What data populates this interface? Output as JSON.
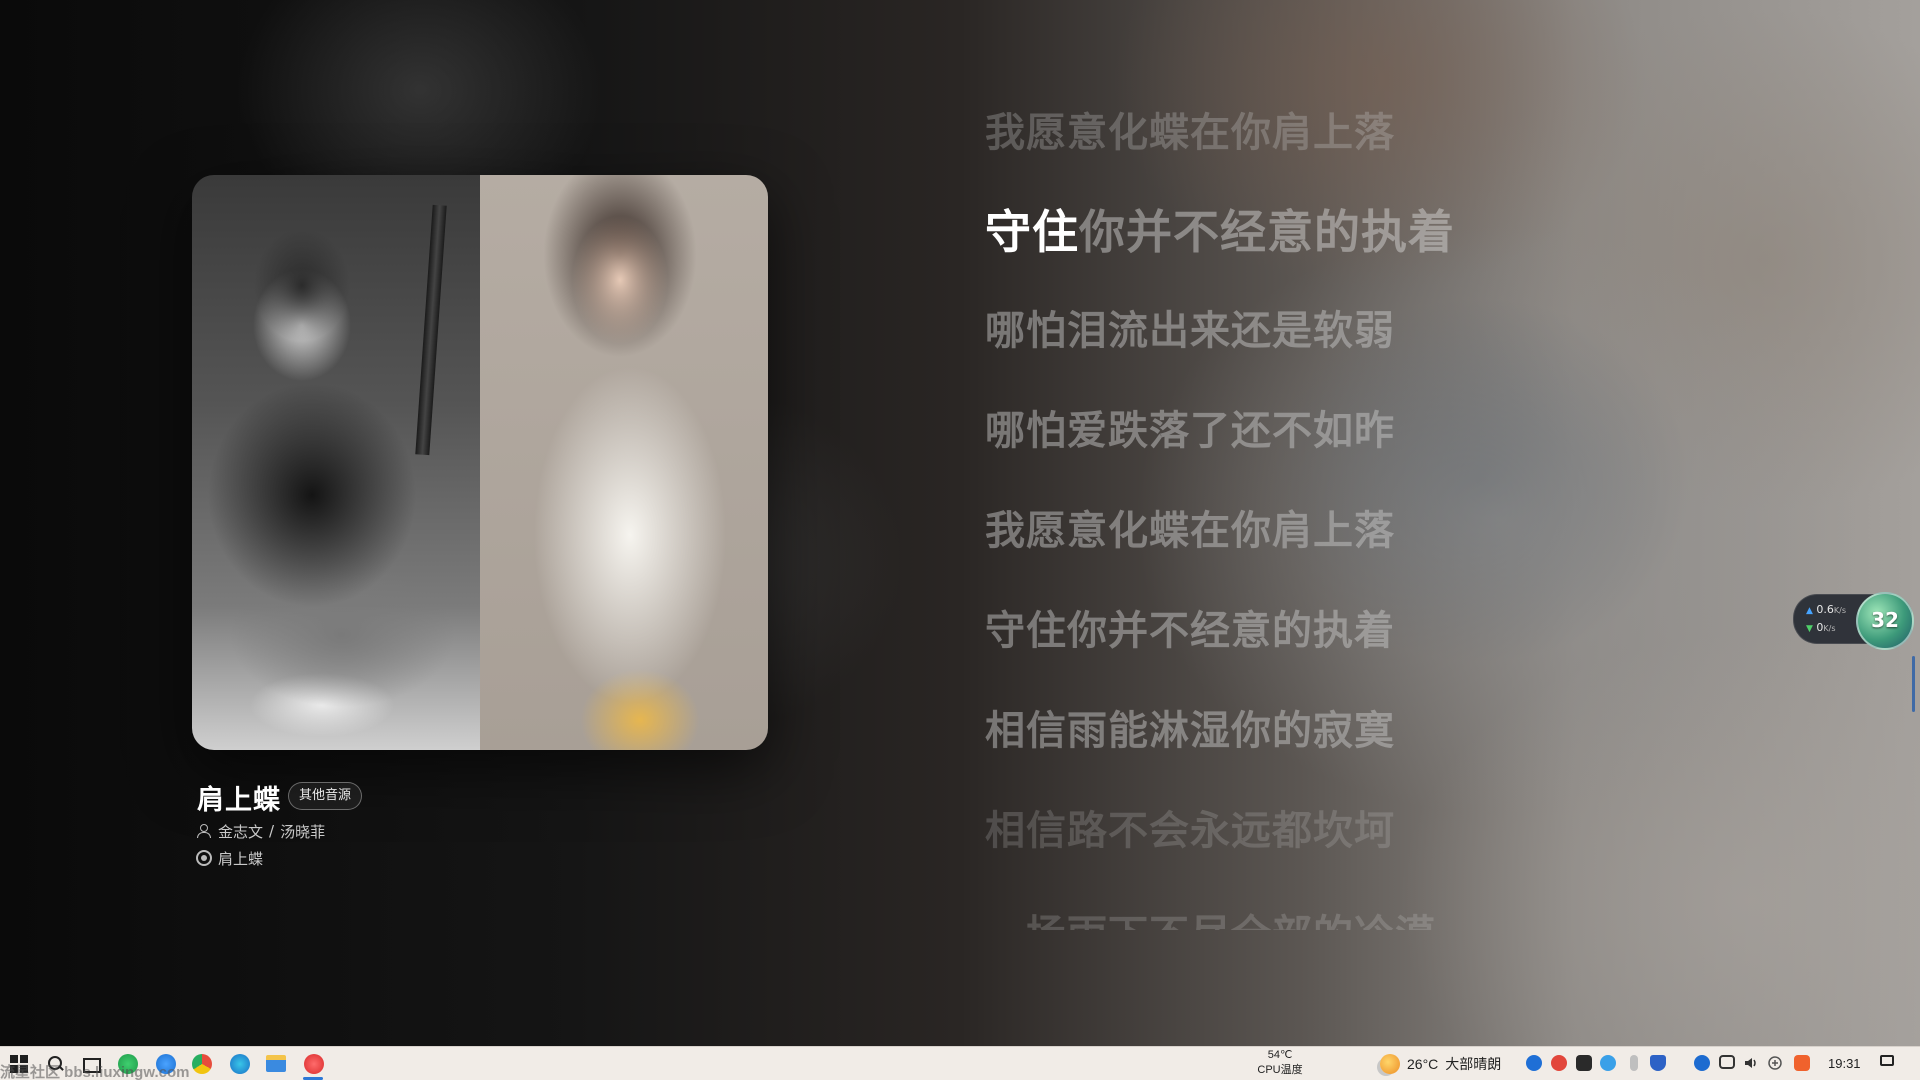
{
  "song": {
    "title": "肩上蝶",
    "source_button": "其他音源",
    "artist_1": "金志文",
    "artist_separator": "/",
    "artist_2": "汤晓菲",
    "album": "肩上蝶"
  },
  "lyrics": [
    {
      "text": "我愿意化蝶在你肩上落",
      "state": "past"
    },
    {
      "sung": "守住",
      "unsung": "你并不经意的执着",
      "state": "current"
    },
    {
      "text": "哪怕泪流出来还是软弱",
      "state": "upcoming"
    },
    {
      "text": "哪怕爱跌落了还不如昨",
      "state": "upcoming"
    },
    {
      "text": "我愿意化蝶在你肩上落",
      "state": "upcoming"
    },
    {
      "text": "守住你并不经意的执着",
      "state": "upcoming"
    },
    {
      "text": "相信雨能淋湿你的寂寞",
      "state": "upcoming"
    },
    {
      "text": "相信路不会永远都坎坷",
      "state": "upcoming"
    },
    {
      "text": "一场雨下不尽全部的冷漠",
      "state": "upcoming-cut"
    }
  ],
  "net_widget": {
    "up_value": "0.6",
    "up_unit": "K/s",
    "down_value": "0",
    "down_unit": "K/s",
    "ball_value": "32"
  },
  "taskbar": {
    "watermark": "流星社区 bbs.liuxingw.com",
    "cpu_temp_value": "54℃",
    "cpu_temp_label": "CPU温度",
    "weather_temp": "26°C",
    "weather_desc": "大部晴朗",
    "clock": "19:31"
  },
  "colors": {
    "accent": "#2d78d6",
    "lyric_current": "#ffffff",
    "taskbar_bg": "#f1ece7"
  },
  "icons": {
    "start": "windows-start-icon",
    "search": "search-icon",
    "taskview": "task-view-icon",
    "weather": "sun-cloud-icon",
    "notification": "notification-icon"
  }
}
